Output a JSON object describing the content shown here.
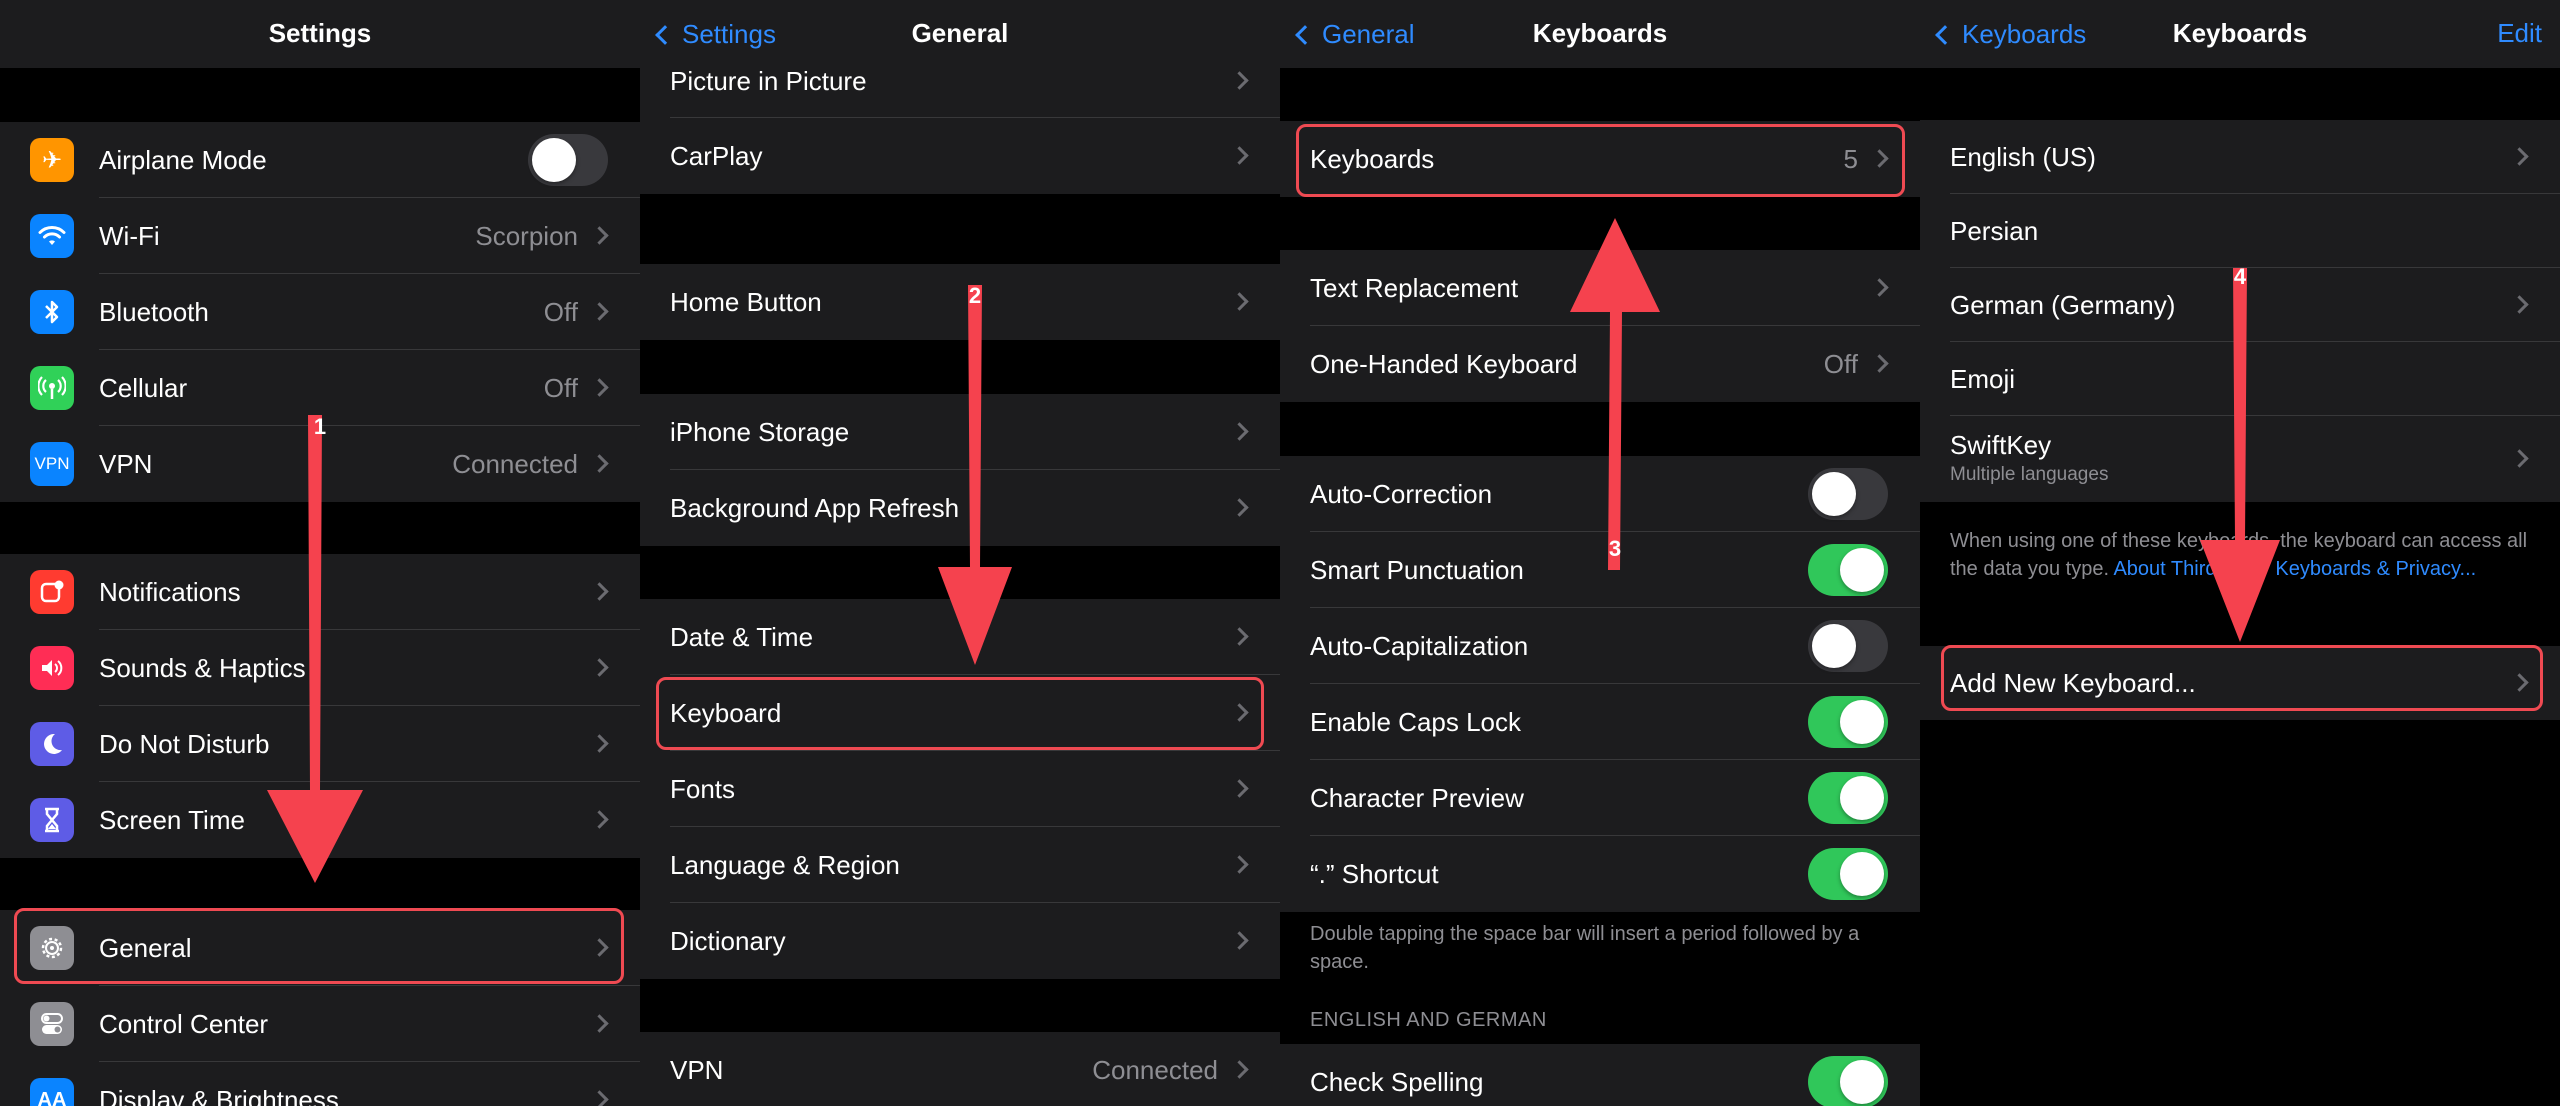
{
  "panel1": {
    "title": "Settings",
    "group1": [
      {
        "label": "Airplane Mode",
        "icon": "airplane-icon",
        "icon_color": "#ff9500",
        "toggle": false
      },
      {
        "label": "Wi-Fi",
        "icon": "wifi-icon",
        "icon_color": "#0a84ff",
        "value": "Scorpion"
      },
      {
        "label": "Bluetooth",
        "icon": "bluetooth-icon",
        "icon_color": "#0a84ff",
        "value": "Off"
      },
      {
        "label": "Cellular",
        "icon": "cellular-icon",
        "icon_color": "#30d158",
        "value": "Off"
      },
      {
        "label": "VPN",
        "icon": "vpn-icon",
        "icon_color": "#0a84ff",
        "value": "Connected",
        "icon_text": "VPN"
      }
    ],
    "group2": [
      {
        "label": "Notifications",
        "icon": "notifications-icon",
        "icon_color": "#ff3b30"
      },
      {
        "label": "Sounds & Haptics",
        "icon": "speaker-icon",
        "icon_color": "#ff2d55"
      },
      {
        "label": "Do Not Disturb",
        "icon": "moon-icon",
        "icon_color": "#5e5ce6"
      },
      {
        "label": "Screen Time",
        "icon": "hourglass-icon",
        "icon_color": "#5e5ce6"
      }
    ],
    "group3": [
      {
        "label": "General",
        "icon": "gear-icon",
        "icon_color": "#8e8e93"
      },
      {
        "label": "Control Center",
        "icon": "switches-icon",
        "icon_color": "#8e8e93"
      },
      {
        "label": "Display & Brightness",
        "icon": "display-icon",
        "icon_color": "#0a84ff",
        "icon_text": "AA"
      }
    ],
    "step": "1"
  },
  "panel2": {
    "back": "Settings",
    "title": "General",
    "group1": [
      {
        "label": "Picture in Picture"
      },
      {
        "label": "CarPlay"
      }
    ],
    "group2": [
      {
        "label": "Home Button"
      }
    ],
    "group3": [
      {
        "label": "iPhone Storage"
      },
      {
        "label": "Background App Refresh"
      }
    ],
    "group4": [
      {
        "label": "Date & Time"
      },
      {
        "label": "Keyboard"
      },
      {
        "label": "Fonts"
      },
      {
        "label": "Language & Region"
      },
      {
        "label": "Dictionary"
      }
    ],
    "group5": [
      {
        "label": "VPN",
        "value": "Connected"
      }
    ],
    "step": "2"
  },
  "panel3": {
    "back": "General",
    "title": "Keyboards",
    "group1": [
      {
        "label": "Keyboards",
        "value": "5"
      }
    ],
    "group2": [
      {
        "label": "Text Replacement"
      },
      {
        "label": "One-Handed Keyboard",
        "value": "Off"
      }
    ],
    "group3": [
      {
        "label": "Auto-Correction",
        "toggle": false
      },
      {
        "label": "Smart Punctuation",
        "toggle": true
      },
      {
        "label": "Auto-Capitalization",
        "toggle": false
      },
      {
        "label": "Enable Caps Lock",
        "toggle": true
      },
      {
        "label": "Character Preview",
        "toggle": true
      },
      {
        "label": "“.” Shortcut",
        "toggle": true
      }
    ],
    "footnote": "Double tapping the space bar will insert a period followed by a space.",
    "section_header": "ENGLISH AND GERMAN",
    "group4": [
      {
        "label": "Check Spelling",
        "toggle": true
      }
    ],
    "step": "3"
  },
  "panel4": {
    "back": "Keyboards",
    "title": "Keyboards",
    "edit": "Edit",
    "group1": [
      {
        "label": "English (US)",
        "chevron": true
      },
      {
        "label": "Persian",
        "chevron": false
      },
      {
        "label": "German (Germany)",
        "chevron": true
      },
      {
        "label": "Emoji",
        "chevron": false
      },
      {
        "label": "SwiftKey",
        "sub": "Multiple languages",
        "chevron": true
      }
    ],
    "footnote_text": "When using one of these keyboards, the keyboard can access all the data you type. ",
    "footnote_link": "About Third-Party Keyboards & Privacy...",
    "group2": [
      {
        "label": "Add New Keyboard...",
        "chevron": true
      }
    ],
    "step": "4"
  },
  "colors": {
    "highlight": "#ef4a52",
    "arrow": "#f5424e",
    "link": "#2f8bff",
    "toggle_on": "#30c75a"
  }
}
